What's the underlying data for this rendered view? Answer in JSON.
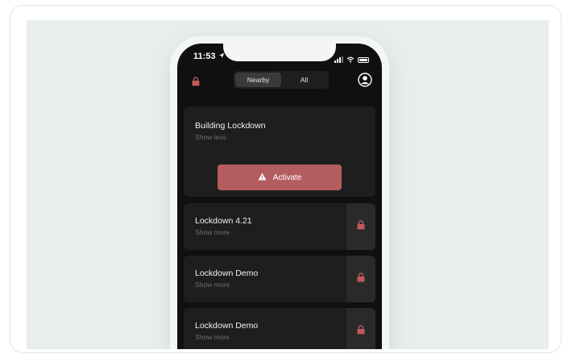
{
  "status_bar": {
    "time": "11:53"
  },
  "segmented": {
    "nearby": "Nearby",
    "all": "All"
  },
  "cards": [
    {
      "title": "Building Lockdown",
      "sub": "Show less",
      "button": "Activate"
    },
    {
      "title": "Lockdown 4.21",
      "sub": "Show more"
    },
    {
      "title": "Lockdown Demo",
      "sub": "Show more"
    },
    {
      "title": "Lockdown Demo",
      "sub": "Show more"
    }
  ],
  "colors": {
    "accent": "#b35d5f",
    "card": "#1e1e1e",
    "screen": "#101010",
    "backdrop": "#e8eeee"
  },
  "icons": [
    "location-arrow-icon",
    "signal-icon",
    "wifi-icon",
    "battery-icon",
    "lock-icon",
    "profile-icon",
    "warning-icon"
  ]
}
